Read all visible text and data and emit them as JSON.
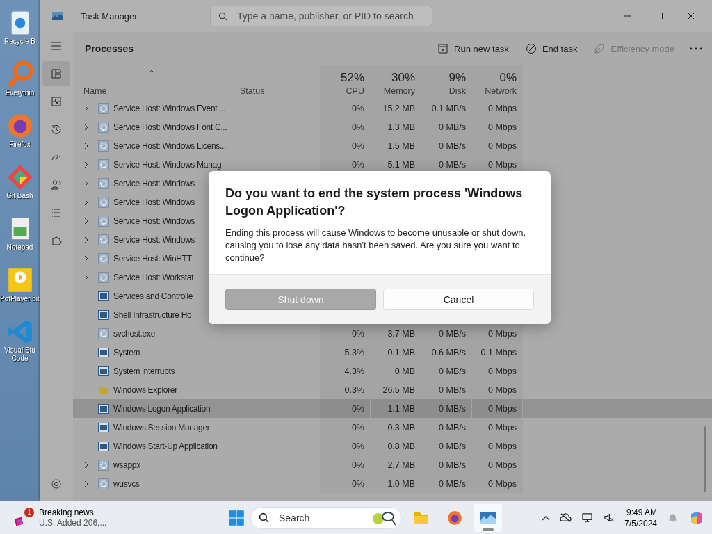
{
  "desktop_icons": [
    {
      "label": "Recycle B",
      "kind": "recycle"
    },
    {
      "label": "Everythin",
      "kind": "search"
    },
    {
      "label": "Firefox",
      "kind": "firefox"
    },
    {
      "label": "Git Bash",
      "kind": "git"
    },
    {
      "label": "Notepad",
      "kind": "notepad"
    },
    {
      "label": "PotPlayer bit",
      "kind": "player"
    },
    {
      "label": "Visual Stu Code",
      "kind": "code"
    }
  ],
  "window": {
    "title": "Task Manager",
    "search": {
      "placeholder": "Type a name, publisher, or PID to search"
    }
  },
  "nav": [
    {
      "kind": "menu",
      "selected": false
    },
    {
      "kind": "processes",
      "selected": true
    },
    {
      "kind": "performance",
      "selected": false
    },
    {
      "kind": "history",
      "selected": false
    },
    {
      "kind": "startup",
      "selected": false
    },
    {
      "kind": "users",
      "selected": false
    },
    {
      "kind": "details",
      "selected": false
    },
    {
      "kind": "services",
      "selected": false
    }
  ],
  "toolbar": {
    "title": "Processes",
    "actions": [
      {
        "label": "Run new task",
        "kind": "run",
        "disabled": false
      },
      {
        "label": "End task",
        "kind": "end",
        "disabled": false
      },
      {
        "label": "Efficiency mode",
        "kind": "leaf",
        "disabled": true
      }
    ]
  },
  "columns": [
    {
      "label": "Name"
    },
    {
      "label": "Status"
    },
    {
      "label": "CPU",
      "total": "52%"
    },
    {
      "label": "Memory",
      "total": "30%"
    },
    {
      "label": "Disk",
      "total": "9%"
    },
    {
      "label": "Network",
      "total": "0%"
    }
  ],
  "rows": [
    {
      "name": "Service Host: Windows Event ...",
      "kind": "service",
      "expandable": true,
      "selected": false,
      "cpu": "0%",
      "memory": "15.2 MB",
      "disk": "0.1 MB/s",
      "network": "0 Mbps"
    },
    {
      "name": "Service Host: Windows Font C...",
      "kind": "service",
      "expandable": true,
      "selected": false,
      "cpu": "0%",
      "memory": "1.3 MB",
      "disk": "0 MB/s",
      "network": "0 Mbps"
    },
    {
      "name": "Service Host: Windows Licens...",
      "kind": "service",
      "expandable": true,
      "selected": false,
      "cpu": "0%",
      "memory": "1.5 MB",
      "disk": "0 MB/s",
      "network": "0 Mbps"
    },
    {
      "name": "Service Host: Windows Manag",
      "kind": "service",
      "expandable": true,
      "selected": false,
      "cpu": "0%",
      "memory": "5.1 MB",
      "disk": "0 MB/s",
      "network": "0 Mbps"
    },
    {
      "name": "Service Host: Windows",
      "kind": "service",
      "expandable": true,
      "selected": false
    },
    {
      "name": "Service Host: Windows",
      "kind": "service",
      "expandable": true,
      "selected": false
    },
    {
      "name": "Service Host: Windows",
      "kind": "service",
      "expandable": true,
      "selected": false
    },
    {
      "name": "Service Host: Windows",
      "kind": "service",
      "expandable": true,
      "selected": false
    },
    {
      "name": "Service Host: WinHTT",
      "kind": "service",
      "expandable": true,
      "selected": false
    },
    {
      "name": "Service Host: Workstat",
      "kind": "service",
      "expandable": true,
      "selected": false
    },
    {
      "name": "Services and Controlle",
      "kind": "app",
      "expandable": false,
      "selected": false
    },
    {
      "name": "Shell Infrastructure Ho",
      "kind": "app",
      "expandable": false,
      "selected": false
    },
    {
      "name": "svchost.exe",
      "kind": "service",
      "expandable": false,
      "selected": false,
      "cpu": "0%",
      "memory": "3.7 MB",
      "disk": "0 MB/s",
      "network": "0 Mbps"
    },
    {
      "name": "System",
      "kind": "app",
      "expandable": false,
      "selected": false,
      "cpu": "5.3%",
      "memory": "0.1 MB",
      "disk": "0.6 MB/s",
      "network": "0.1 Mbps"
    },
    {
      "name": "System interrupts",
      "kind": "app",
      "expandable": false,
      "selected": false,
      "cpu": "4.3%",
      "memory": "0 MB",
      "disk": "0 MB/s",
      "network": "0 Mbps"
    },
    {
      "name": "Windows Explorer",
      "kind": "folder",
      "expandable": false,
      "selected": false,
      "cpu": "0.3%",
      "memory": "26.5 MB",
      "disk": "0 MB/s",
      "network": "0 Mbps"
    },
    {
      "name": "Windows Logon Application",
      "kind": "app",
      "expandable": false,
      "selected": true,
      "cpu": "0%",
      "memory": "1.1 MB",
      "disk": "0 MB/s",
      "network": "0 Mbps"
    },
    {
      "name": "Windows Session Manager",
      "kind": "app",
      "expandable": false,
      "selected": false,
      "cpu": "0%",
      "memory": "0.3 MB",
      "disk": "0 MB/s",
      "network": "0 Mbps"
    },
    {
      "name": "Windows Start-Up Application",
      "kind": "app",
      "expandable": false,
      "selected": false,
      "cpu": "0%",
      "memory": "0.8 MB",
      "disk": "0 MB/s",
      "network": "0 Mbps"
    },
    {
      "name": "wsappx",
      "kind": "service",
      "expandable": true,
      "selected": false,
      "cpu": "0%",
      "memory": "2.7 MB",
      "disk": "0 MB/s",
      "network": "0 Mbps"
    },
    {
      "name": "wusvcs",
      "kind": "service",
      "expandable": true,
      "selected": false,
      "cpu": "0%",
      "memory": "1.0 MB",
      "disk": "0 MB/s",
      "network": "0 Mbps"
    }
  ],
  "dialog": {
    "title": "Do you want to end the system process 'Windows Logon Application'?",
    "message": "Ending this process will cause Windows to become unusable or shut down, causing you to lose any data hasn't been saved. Are you sure you want to continue?",
    "buttons": [
      {
        "label": "Shut down",
        "primary": true
      },
      {
        "label": "Cancel",
        "primary": false
      }
    ]
  },
  "taskbar": {
    "news": {
      "badge": "1",
      "title": "Breaking news",
      "subtitle": "U.S. Added 206,..."
    },
    "search": {
      "placeholder": "Search"
    },
    "apps": [
      {
        "kind": "explorer",
        "active": false
      },
      {
        "kind": "firefox",
        "active": false
      },
      {
        "kind": "taskmanager",
        "active": true
      }
    ],
    "time": "9:49 AM",
    "date": "7/5/2024"
  }
}
